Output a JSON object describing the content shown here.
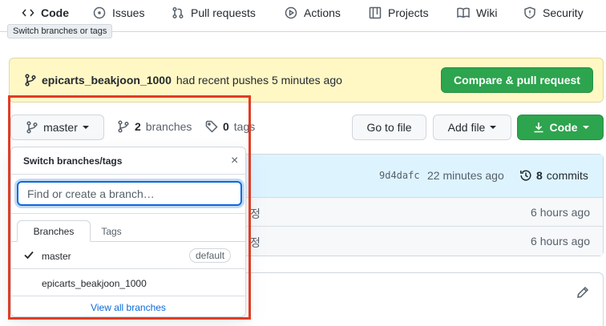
{
  "nav": {
    "tabs": [
      {
        "label": "Code",
        "icon": "code-icon",
        "active": true
      },
      {
        "label": "Issues",
        "icon": "issue-icon"
      },
      {
        "label": "Pull requests",
        "icon": "pull-request-icon"
      },
      {
        "label": "Actions",
        "icon": "play-icon"
      },
      {
        "label": "Projects",
        "icon": "table-icon"
      },
      {
        "label": "Wiki",
        "icon": "book-icon"
      },
      {
        "label": "Security",
        "icon": "shield-icon"
      }
    ]
  },
  "tooltip": "Switch branches or tags",
  "banner": {
    "branch": "epicarts_beakjoon_1000",
    "message": "had recent pushes 5 minutes ago",
    "button": "Compare & pull request"
  },
  "toolbar": {
    "branch_button": "master",
    "branches_count": "2",
    "branches_label": "branches",
    "tags_count": "0",
    "tags_label": "tags",
    "goto_file": "Go to file",
    "add_file": "Add file",
    "code": "Code"
  },
  "commit": {
    "hash": "9d4dafc",
    "time": "22 minutes ago",
    "count": "8",
    "count_label": "commits"
  },
  "files": [
    {
      "message": "정",
      "age": "6 hours ago"
    },
    {
      "message": "정",
      "age": "6 hours ago"
    }
  ],
  "dropdown": {
    "title": "Switch branches/tags",
    "close": "×",
    "search_placeholder": "Find or create a branch…",
    "tabs": [
      "Branches",
      "Tags"
    ],
    "items": [
      {
        "name": "master",
        "badge": "default",
        "checked": true
      },
      {
        "name": "epicarts_beakjoon_1000"
      }
    ],
    "view_all": "View all branches"
  },
  "colors": {
    "accent": "#0969da",
    "primary_button": "#2da44e",
    "banner_bg": "#fff8c5",
    "highlight": "#e03c24"
  }
}
